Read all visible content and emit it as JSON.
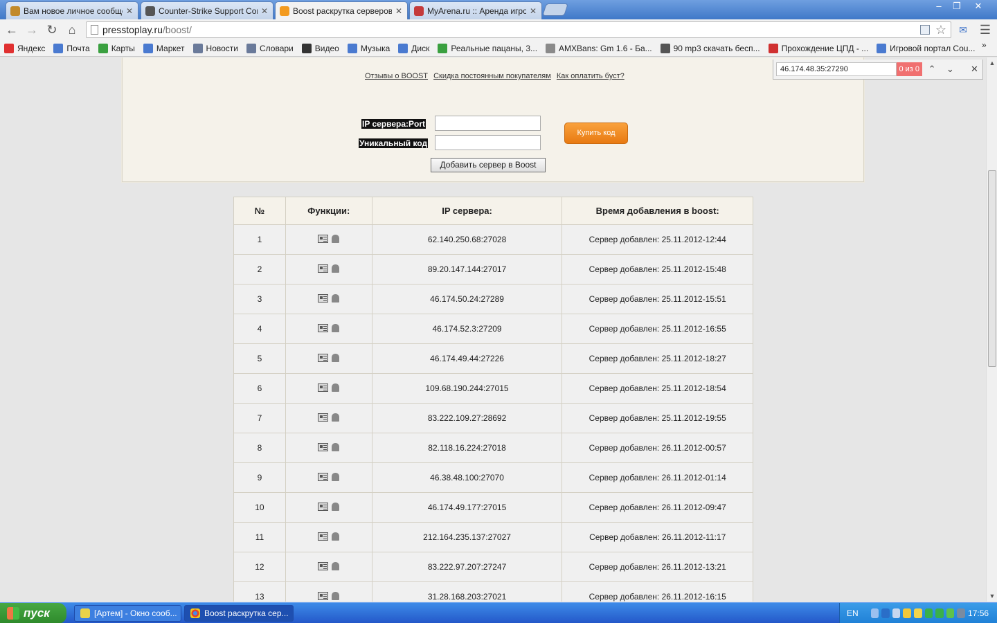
{
  "browser": {
    "tabs": [
      {
        "title": "Вам новое личное сообщен",
        "icon": "forum-icon",
        "color": "#c28a2a"
      },
      {
        "title": "Counter-Strike Support Comr",
        "icon": "cs-icon",
        "color": "#555555"
      },
      {
        "title": "Boost раскрутка серверов",
        "icon": "p-icon",
        "color": "#f39a1e",
        "active": true
      },
      {
        "title": "MyArena.ru :: Аренда игрог",
        "icon": "myarena-icon",
        "color": "#c43a3a"
      }
    ],
    "url_host": "presstoplay.ru",
    "url_path": "/boost/",
    "bookmarks": [
      {
        "label": "Яндекс",
        "color": "#e03030"
      },
      {
        "label": "Почта",
        "color": "#4a7ad0"
      },
      {
        "label": "Карты",
        "color": "#3aa040"
      },
      {
        "label": "Маркет",
        "color": "#4a7ad0"
      },
      {
        "label": "Новости",
        "color": "#6a7a9a"
      },
      {
        "label": "Словари",
        "color": "#6a7a9a"
      },
      {
        "label": "Видео",
        "color": "#333333"
      },
      {
        "label": "Музыка",
        "color": "#4a7ad0"
      },
      {
        "label": "Диск",
        "color": "#4a7ad0"
      },
      {
        "label": "Реальные пацаны, 3...",
        "color": "#3aa040"
      },
      {
        "label": "AMXBans: Gm 1.6 - Ба...",
        "color": "#8a8a8a"
      },
      {
        "label": "90 mp3 скачать бесп...",
        "color": "#555555"
      },
      {
        "label": "Прохождение ЦПД - ...",
        "color": "#d03030"
      },
      {
        "label": "Игровой портал Cou...",
        "color": "#4a7ad0"
      }
    ]
  },
  "find": {
    "query": "46.174.48.35:27290",
    "count": "0 из 0"
  },
  "panel": {
    "links": [
      "Отзывы о BOOST",
      "Скидка постоянным покупателям",
      "Как оплатить буст?"
    ],
    "ip_label": "IP сервера:Port",
    "code_label": "Уникальный код",
    "buy_button": "Купить код",
    "add_button": "Добавить сервер в Boost"
  },
  "table": {
    "headers": [
      "№",
      "Функции:",
      "IP сервера:",
      "Время добавления в boost:"
    ],
    "rows": [
      {
        "n": "1",
        "ip": "62.140.250.68:27028",
        "time": "Сервер добавлен: 25.11.2012-12:44"
      },
      {
        "n": "2",
        "ip": "89.20.147.144:27017",
        "time": "Сервер добавлен: 25.11.2012-15:48"
      },
      {
        "n": "3",
        "ip": "46.174.50.24:27289",
        "time": "Сервер добавлен: 25.11.2012-15:51"
      },
      {
        "n": "4",
        "ip": "46.174.52.3:27209",
        "time": "Сервер добавлен: 25.11.2012-16:55"
      },
      {
        "n": "5",
        "ip": "46.174.49.44:27226",
        "time": "Сервер добавлен: 25.11.2012-18:27"
      },
      {
        "n": "6",
        "ip": "109.68.190.244:27015",
        "time": "Сервер добавлен: 25.11.2012-18:54"
      },
      {
        "n": "7",
        "ip": "83.222.109.27:28692",
        "time": "Сервер добавлен: 25.11.2012-19:55"
      },
      {
        "n": "8",
        "ip": "82.118.16.224:27018",
        "time": "Сервер добавлен: 26.11.2012-00:57"
      },
      {
        "n": "9",
        "ip": "46.38.48.100:27070",
        "time": "Сервер добавлен: 26.11.2012-01:14"
      },
      {
        "n": "10",
        "ip": "46.174.49.177:27015",
        "time": "Сервер добавлен: 26.11.2012-09:47"
      },
      {
        "n": "11",
        "ip": "212.164.235.137:27027",
        "time": "Сервер добавлен: 26.11.2012-11:17"
      },
      {
        "n": "12",
        "ip": "83.222.97.207:27247",
        "time": "Сервер добавлен: 26.11.2012-13:21"
      },
      {
        "n": "13",
        "ip": "31.28.168.203:27021",
        "time": "Сервер добавлен: 26.11.2012-16:15"
      }
    ]
  },
  "taskbar": {
    "start": "пуск",
    "tasks": [
      "[Артем] - Окно сооб...",
      "Boost раскрутка сер..."
    ],
    "lang": "EN",
    "clock": "17:56"
  }
}
